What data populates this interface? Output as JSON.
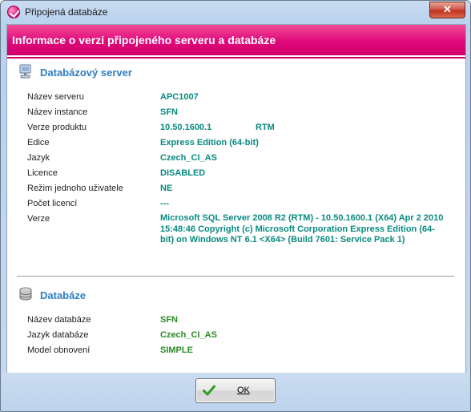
{
  "window": {
    "title": "Připojená databáze",
    "close_symbol": "✕"
  },
  "banner": {
    "title": "Informace o verzi připojeného serveru a databáze"
  },
  "server_section": {
    "icon": "server-icon",
    "title": "Databázový server",
    "rows": [
      {
        "label": "Název serveru",
        "value": "APC1007"
      },
      {
        "label": "Název instance",
        "value": "SFN"
      },
      {
        "label": "Verze produktu",
        "value": "10.50.1600.1",
        "value2": "RTM"
      },
      {
        "label": "Edice",
        "value": "Express Edition (64-bit)"
      },
      {
        "label": "Jazyk",
        "value": "Czech_CI_AS"
      },
      {
        "label": "Licence",
        "value": "DISABLED"
      },
      {
        "label": "Režim jednoho uživatele",
        "value": "NE"
      },
      {
        "label": "Počet licencí",
        "value": "---"
      },
      {
        "label": "Verze",
        "value": "Microsoft SQL Server 2008 R2 (RTM) - 10.50.1600.1 (X64)  Apr 2 2010 15:48:46  Copyright (c) Microsoft Corporation Express Edition (64-bit) on Windows NT 6.1 <X64> (Build 7601: Service Pack 1)"
      }
    ]
  },
  "database_section": {
    "icon": "database-icon",
    "title": "Databáze",
    "rows": [
      {
        "label": "Název databáze",
        "value": "SFN"
      },
      {
        "label": "Jazyk databáze",
        "value": "Czech_CI_AS"
      },
      {
        "label": "Model obnovení",
        "value": "SIMPLE"
      }
    ]
  },
  "footer": {
    "ok_label": "OK",
    "ok_icon": "checkmark-icon"
  },
  "colors": {
    "banner": "#e0077a",
    "section_title": "#2e7ec0",
    "server_value": "#0a8a80",
    "database_value": "#2a8c24"
  }
}
